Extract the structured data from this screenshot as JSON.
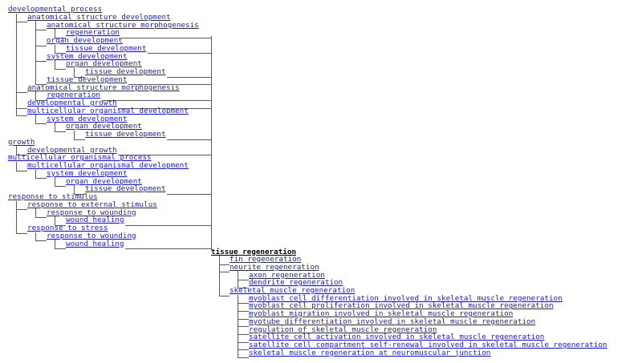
{
  "tree": {
    "focus_term": "tissue regeneration",
    "colors": {
      "link": "#1a1ad0",
      "focus": "#000000",
      "connector": "#5a5a5a"
    },
    "ancestors": [
      {
        "label": "developmental process",
        "depth": 0
      },
      {
        "label": "anatomical structure development",
        "depth": 1
      },
      {
        "label": "anatomical structure morphogenesis",
        "depth": 2
      },
      {
        "label": "regeneration",
        "depth": 3
      },
      {
        "label": "organ development",
        "depth": 2
      },
      {
        "label": "tissue development",
        "depth": 3
      },
      {
        "label": "system development",
        "depth": 2
      },
      {
        "label": "organ development",
        "depth": 3
      },
      {
        "label": "tissue development",
        "depth": 4
      },
      {
        "label": "tissue development",
        "depth": 2
      },
      {
        "label": "anatomical structure morphogenesis",
        "depth": 1
      },
      {
        "label": "regeneration",
        "depth": 2
      },
      {
        "label": "developmental growth",
        "depth": 1
      },
      {
        "label": "multicellular organismal development",
        "depth": 1
      },
      {
        "label": "system development",
        "depth": 2
      },
      {
        "label": "organ development",
        "depth": 3
      },
      {
        "label": "tissue development",
        "depth": 4
      },
      {
        "label": "growth",
        "depth": 0
      },
      {
        "label": "developmental growth",
        "depth": 1
      },
      {
        "label": "multicellular organismal process",
        "depth": 0
      },
      {
        "label": "multicellular organismal development",
        "depth": 1
      },
      {
        "label": "system development",
        "depth": 2
      },
      {
        "label": "organ development",
        "depth": 3
      },
      {
        "label": "tissue development",
        "depth": 4
      },
      {
        "label": "response to stimulus",
        "depth": 0
      },
      {
        "label": "response to external stimulus",
        "depth": 1
      },
      {
        "label": "response to wounding",
        "depth": 2
      },
      {
        "label": "wound healing",
        "depth": 3
      },
      {
        "label": "response to stress",
        "depth": 1
      },
      {
        "label": "response to wounding",
        "depth": 2
      },
      {
        "label": "wound healing",
        "depth": 3
      }
    ],
    "descendants": [
      {
        "label": "fin regeneration",
        "depth": 1
      },
      {
        "label": "neurite regeneration",
        "depth": 1
      },
      {
        "label": "axon regeneration",
        "depth": 2
      },
      {
        "label": "dendrite regeneration",
        "depth": 2
      },
      {
        "label": "skeletal muscle regeneration",
        "depth": 1
      },
      {
        "label": "myoblast cell differentiation involved in skeletal muscle regeneration",
        "depth": 2
      },
      {
        "label": "myoblast cell proliferation involved in skeletal muscle regeneration",
        "depth": 2
      },
      {
        "label": "myoblast migration involved in skeletal muscle regeneration",
        "depth": 2
      },
      {
        "label": "myotube differentiation involved in skeletal muscle regeneration",
        "depth": 2
      },
      {
        "label": "regulation of skeletal muscle regeneration",
        "depth": 2
      },
      {
        "label": "satellite cell activation involved in skeletal muscle regeneration",
        "depth": 2
      },
      {
        "label": "satellite cell compartment self-renewal involved in skeletal muscle regeneration",
        "depth": 2
      },
      {
        "label": "skeletal muscle regeneration at neuromuscular junction",
        "depth": 2
      }
    ]
  }
}
